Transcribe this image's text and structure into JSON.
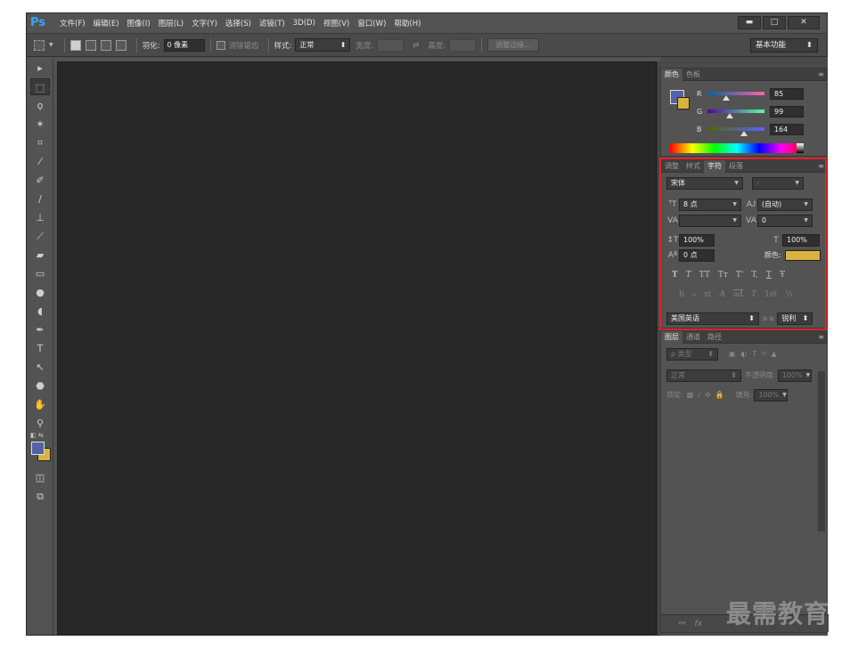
{
  "app": {
    "logo": "Ps",
    "menus": [
      "文件(F)",
      "编辑(E)",
      "图像(I)",
      "图层(L)",
      "文字(Y)",
      "选择(S)",
      "滤镜(T)",
      "3D(D)",
      "视图(V)",
      "窗口(W)",
      "帮助(H)"
    ],
    "window_buttons": {
      "minimize": "▬",
      "maximize": "□",
      "close": "✕"
    }
  },
  "options": {
    "feather_label": "羽化:",
    "feather_value": "0 像素",
    "antialias_label": "消除锯齿",
    "style_label": "样式:",
    "style_value": "正常",
    "width_label": "宽度:",
    "height_label": "高度:",
    "refine_edge_button": "调整边缘...",
    "workspace": "基本功能"
  },
  "color_panel": {
    "tabs": [
      "颜色",
      "色板"
    ],
    "r_label": "R",
    "r_value": "85",
    "g_label": "G",
    "g_value": "99",
    "b_label": "B",
    "b_value": "164",
    "r_fraction": 0.333,
    "g_fraction": 0.388,
    "b_fraction": 0.643,
    "foreground_color": "#5563a4",
    "background_color": "#d9b33e"
  },
  "character_panel": {
    "tabs": [
      "调整",
      "样式",
      "字符",
      "段落"
    ],
    "font_family": "宋体",
    "font_style": "-",
    "font_size": "8 点",
    "leading": "(自动)",
    "kerning": "",
    "tracking": "0",
    "vertical_scale": "100%",
    "horizontal_scale": "100%",
    "baseline_shift": "0 点",
    "color_label": "颜色:",
    "color_value": "#d9b33e",
    "style_buttons": [
      "T",
      "T",
      "TT",
      "Tт",
      "T'",
      "T,",
      "T",
      "Ŧ"
    ],
    "opentype_buttons": [
      "fi",
      "ℴ",
      "st",
      "A",
      "ad",
      "T",
      "1st",
      "½"
    ],
    "language": "美国英语",
    "aa_label": "a a",
    "antialias": "锐利"
  },
  "layers_panel": {
    "tabs": [
      "图层",
      "通道",
      "路径"
    ],
    "filter_label": "ρ 类型",
    "blend_mode": "正常",
    "opacity_label": "不透明度:",
    "opacity_value": "100%",
    "lock_label": "锁定:",
    "fill_label": "填充:",
    "fill_value": "100%"
  },
  "watermark": "最需教育"
}
